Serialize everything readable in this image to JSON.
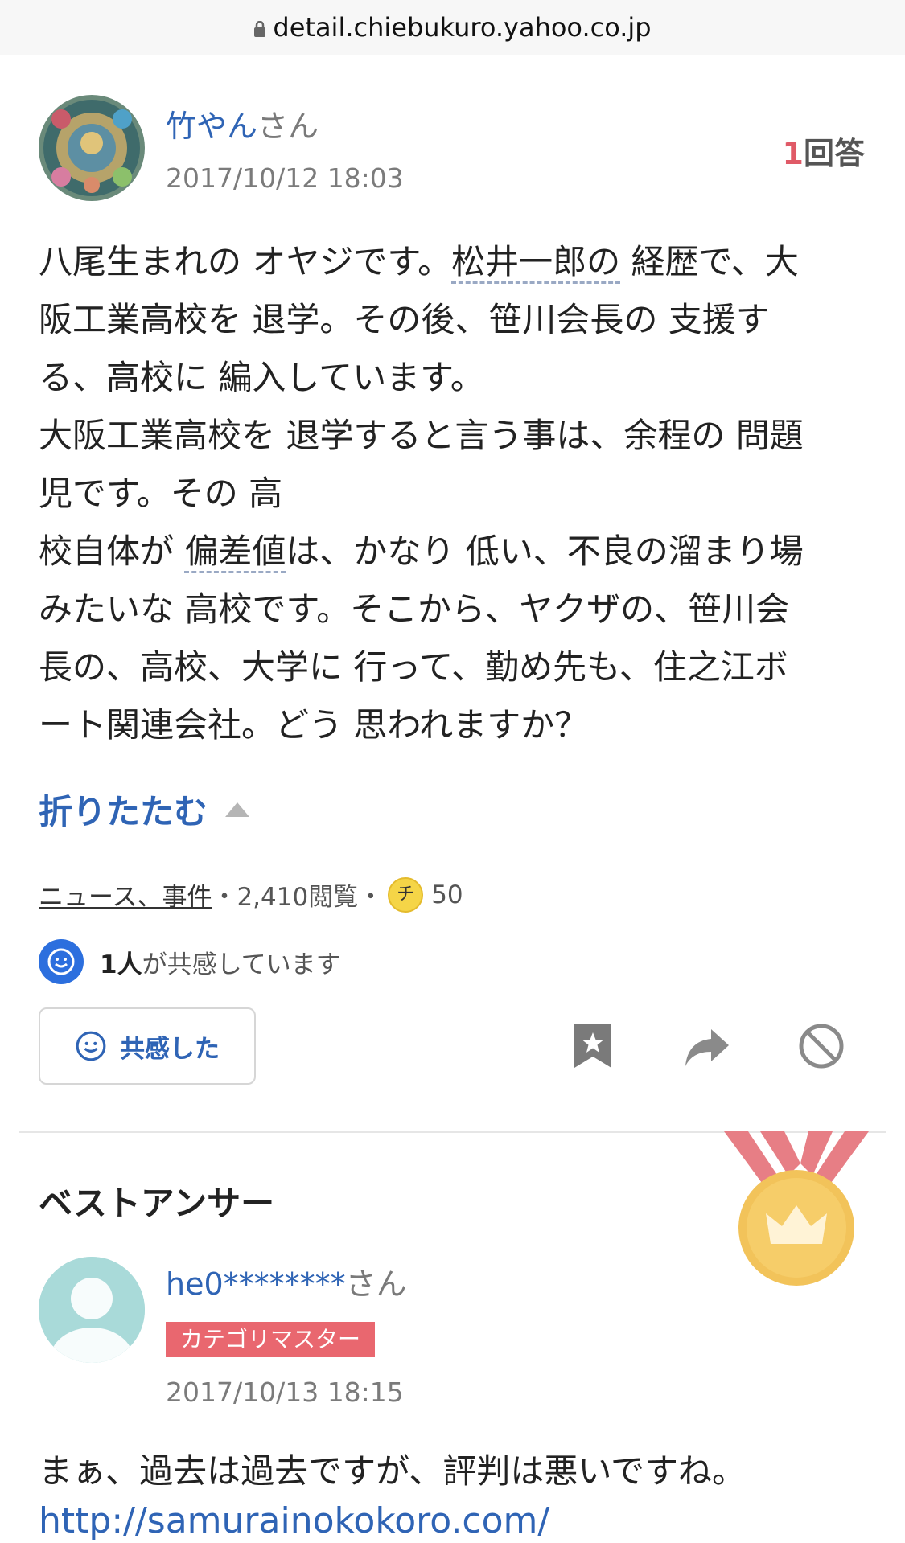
{
  "browser": {
    "url": "detail.chiebukuro.yahoo.co.jp"
  },
  "question": {
    "user_name": "竹やん",
    "honorific": "さん",
    "date": "2017/10/12 18:03",
    "answer_count": "1",
    "answer_label": "回答",
    "body_segments": [
      "八尾生まれの オヤジです。",
      "松井一郎の",
      " 経歴で、大\n阪工業高校を 退学。その後、笹川会長の 支援す\nる、高校に 編入しています。\n大阪工業高校を 退学すると言う事は、余程の 問題\n児です。その 高\n校自体が ",
      "偏差値",
      "は、かなり 低い、不良の溜まり場\nみたいな 高校です。そこから、ヤクザの、笹川会\n長の、高校、大学に 行って、勤め先も、住之江ボ\nート関連会社。どう 思われますか？"
    ],
    "fold_label": "折りたたむ",
    "category": "ニュース、事件",
    "sep": "・",
    "views": "2,410閲覧",
    "coin_symbol": "チ",
    "coins": "50",
    "empathy_count": "1人",
    "empathy_text": "が共感しています",
    "empathy_button": "共感した"
  },
  "icons": [
    "lock-icon",
    "smile-icon",
    "bookmark-star-icon",
    "share-arrow-icon",
    "block-icon",
    "medal-crown-icon"
  ],
  "best_answer": {
    "title": "ベストアンサー",
    "user_name": "he0********",
    "honorific": "さん",
    "badge": "カテゴリマスター",
    "date": "2017/10/13 18:15",
    "body": "まぁ、過去は過去ですが、評判は悪いですね。",
    "link": "http://samurainokokoro.com/"
  },
  "colors": {
    "link_blue": "#2f64b5",
    "accent_red": "#e05a67",
    "badge_red": "#e9676f",
    "empathy_blue": "#2c6fde"
  }
}
